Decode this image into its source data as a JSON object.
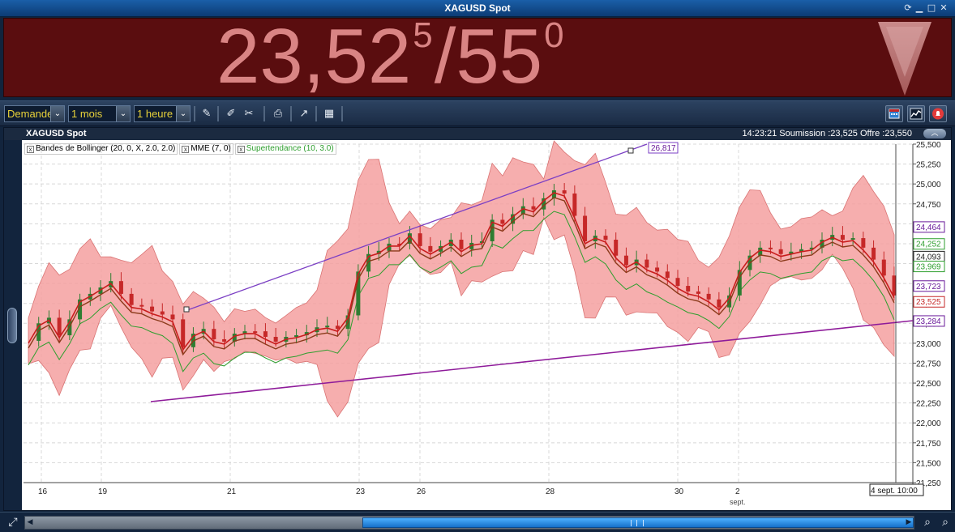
{
  "window": {
    "title": "XAGUSD Spot"
  },
  "quote": {
    "bid_main": "23,52",
    "bid_pip": "5",
    "separator": "/",
    "ask_main": "55",
    "ask_pip": "0",
    "direction": "down",
    "color": "#d98484",
    "background": "#5a0d0f"
  },
  "toolbar": {
    "side_select": "Demande",
    "period_select": "1 mois",
    "interval_select": "1 heure",
    "icons": [
      "pencil-icon",
      "pin-icon",
      "tools-icon",
      "print-icon",
      "chart-type-icon",
      "grid-table-icon"
    ],
    "right_icons": [
      "calendar-icon",
      "chart-icon",
      "alert-icon"
    ]
  },
  "chart": {
    "header_title": "XAGUSD Spot",
    "header_quote": "14:23:21   Soumission :23,525   Offre :23,550",
    "legend": [
      {
        "label": "Bandes de Bollinger (20, 0, X, 2.0, 2.0)",
        "color": "#222222"
      },
      {
        "label": "MME (7, 0)",
        "color": "#222222"
      },
      {
        "label": "Supertendance (10, 3.0)",
        "color": "#2e9e2e"
      }
    ],
    "crosshair_label": "4 sept. 10:00",
    "trendline_label": "26,817",
    "month_label": "sept."
  },
  "chart_data": {
    "type": "candlestick",
    "y_ticks": [
      "25,500",
      "25,250",
      "25,000",
      "24,750",
      "24,500",
      "24,250",
      "24,000",
      "23,750",
      "23,500",
      "23,250",
      "23,000",
      "22,750",
      "22,500",
      "22,250",
      "22,000",
      "21,750",
      "21,500",
      "21,250"
    ],
    "ylim": [
      21.25,
      25.5
    ],
    "x_ticks": [
      "16",
      "19",
      "21",
      "23",
      "26",
      "28",
      "30",
      "2"
    ],
    "price_tags": [
      {
        "value": "24,464",
        "color": "#6a1b9a"
      },
      {
        "value": "24,252",
        "color": "#2e9e2e"
      },
      {
        "value": "24,093",
        "color": "#222222"
      },
      {
        "value": "23,969",
        "color": "#2e9e2e"
      },
      {
        "value": "23,723",
        "color": "#6a1b9a"
      },
      {
        "value": "23,525",
        "color": "#c62828"
      },
      {
        "value": "23,284",
        "color": "#6a1b9a"
      }
    ],
    "close_path": [
      [
        0,
        23.03
      ],
      [
        6,
        23.25
      ],
      [
        12,
        23.32
      ],
      [
        18,
        23.1
      ],
      [
        24,
        23.3
      ],
      [
        30,
        23.55
      ],
      [
        36,
        23.62
      ],
      [
        42,
        23.7
      ],
      [
        48,
        23.78
      ],
      [
        54,
        23.62
      ],
      [
        60,
        23.48
      ],
      [
        66,
        23.46
      ],
      [
        72,
        23.4
      ],
      [
        78,
        23.36
      ],
      [
        84,
        23.3
      ],
      [
        90,
        22.95
      ],
      [
        96,
        23.12
      ],
      [
        102,
        23.18
      ],
      [
        108,
        23.05
      ],
      [
        114,
        23.02
      ],
      [
        120,
        23.12
      ],
      [
        126,
        23.15
      ],
      [
        132,
        23.15
      ],
      [
        138,
        23.08
      ],
      [
        144,
        23.02
      ],
      [
        150,
        23.08
      ],
      [
        156,
        23.1
      ],
      [
        162,
        23.14
      ],
      [
        168,
        23.2
      ],
      [
        174,
        23.22
      ],
      [
        180,
        23.18
      ],
      [
        186,
        23.35
      ],
      [
        192,
        23.9
      ],
      [
        198,
        24.12
      ],
      [
        204,
        24.16
      ],
      [
        210,
        24.25
      ],
      [
        216,
        24.25
      ],
      [
        222,
        24.38
      ],
      [
        228,
        24.22
      ],
      [
        234,
        24.15
      ],
      [
        240,
        24.22
      ],
      [
        246,
        24.3
      ],
      [
        252,
        24.18
      ],
      [
        258,
        24.26
      ],
      [
        264,
        24.28
      ],
      [
        270,
        24.55
      ],
      [
        276,
        24.5
      ],
      [
        282,
        24.62
      ],
      [
        288,
        24.72
      ],
      [
        294,
        24.68
      ],
      [
        300,
        24.82
      ],
      [
        306,
        24.92
      ],
      [
        312,
        24.88
      ],
      [
        318,
        24.6
      ],
      [
        324,
        24.28
      ],
      [
        330,
        24.35
      ],
      [
        336,
        24.3
      ],
      [
        342,
        24.1
      ],
      [
        348,
        23.98
      ],
      [
        354,
        24.05
      ],
      [
        360,
        23.95
      ],
      [
        366,
        23.9
      ],
      [
        372,
        23.82
      ],
      [
        378,
        23.72
      ],
      [
        384,
        23.65
      ],
      [
        390,
        23.62
      ],
      [
        396,
        23.55
      ],
      [
        402,
        23.45
      ],
      [
        408,
        23.6
      ],
      [
        414,
        23.92
      ],
      [
        420,
        24.1
      ],
      [
        426,
        24.2
      ],
      [
        432,
        24.18
      ],
      [
        438,
        24.12
      ],
      [
        444,
        24.15
      ],
      [
        450,
        24.18
      ],
      [
        456,
        24.2
      ],
      [
        462,
        24.3
      ],
      [
        468,
        24.36
      ],
      [
        474,
        24.3
      ],
      [
        480,
        24.32
      ],
      [
        486,
        24.2
      ],
      [
        492,
        24.05
      ],
      [
        498,
        23.85
      ],
      [
        504,
        23.6
      ]
    ],
    "trendlines": [
      {
        "from": [
          "2024-08-20T03:00",
          23.21
        ],
        "to": [
          "2024-08-28T20:00",
          26.817
        ],
        "color": "#7b3fc4"
      },
      {
        "from": [
          "2024-08-19T22:00",
          22.25
        ],
        "to": [
          "2024-09-04T10:00",
          23.284
        ],
        "color": "#8e1b9a"
      }
    ],
    "series": [
      {
        "name": "Bandes de Bollinger",
        "color": "#f5a0a0"
      },
      {
        "name": "MME",
        "color": "#c91d1d"
      },
      {
        "name": "Supertendance",
        "color": "#2e9e2e"
      }
    ]
  }
}
